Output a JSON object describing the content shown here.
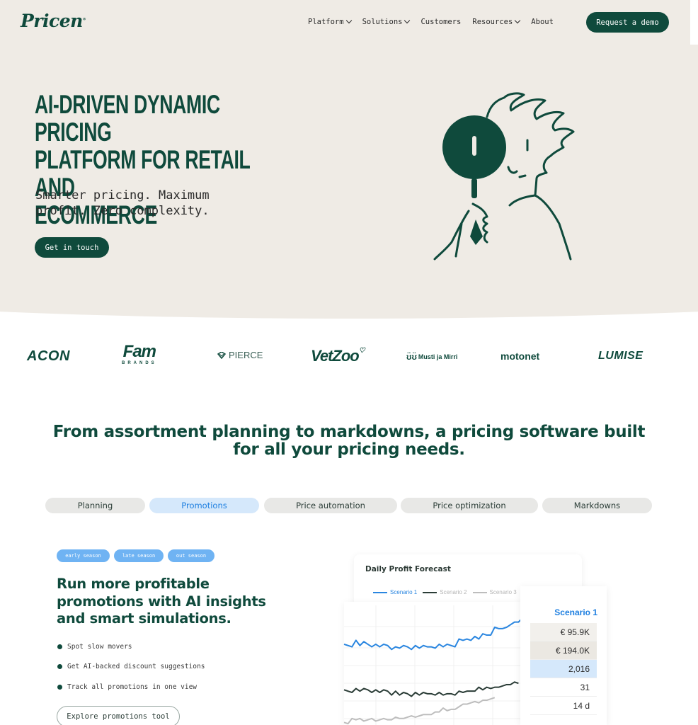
{
  "brand": {
    "name": "Pricen",
    "trademark": "®",
    "primary_color": "#0f4a3c",
    "accent_color": "#1e7fe0"
  },
  "nav": {
    "items": [
      {
        "label": "Platform",
        "has_dropdown": true
      },
      {
        "label": "Solutions",
        "has_dropdown": true
      },
      {
        "label": "Customers",
        "has_dropdown": false
      },
      {
        "label": "Resources",
        "has_dropdown": true
      },
      {
        "label": "About",
        "has_dropdown": false
      }
    ],
    "cta": "Request a demo"
  },
  "hero": {
    "title_lines": [
      "AI-DRIVEN DYNAMIC PRICING",
      "PLATFORM FOR RETAIL AND",
      "ECOMMERCE"
    ],
    "subtitle_lines": [
      "Smarter pricing. Maximum",
      "profit. Zero complexity."
    ],
    "cta": "Get in touch",
    "illustration": "person-with-magnifying-glass"
  },
  "customer_logos": [
    {
      "name": "ACON"
    },
    {
      "name": "Fam",
      "sub": "BRANDS"
    },
    {
      "name": "PIERCE"
    },
    {
      "name": "VetZoo"
    },
    {
      "name": "Musti ja Mirri"
    },
    {
      "name": "motonet"
    },
    {
      "name": "LUMISE"
    }
  ],
  "section": {
    "title_lines": [
      "From assortment planning to markdowns, a pricing software built",
      "for all your pricing needs."
    ],
    "tabs": [
      {
        "label": "Planning",
        "active": false
      },
      {
        "label": "Promotions",
        "active": true
      },
      {
        "label": "Price automation",
        "active": false
      },
      {
        "label": "Price optimization",
        "active": false
      },
      {
        "label": "Markdowns",
        "active": false
      }
    ]
  },
  "feature": {
    "chips": [
      "early season",
      "late season",
      "out season"
    ],
    "title_lines": [
      "Run more profitable",
      "promotions with AI insights",
      "and smart simulations."
    ],
    "bullets": [
      "Spot slow movers",
      "Get AI-backed discount suggestions",
      "Track all promotions in one view"
    ],
    "cta": "Explore promotions tool"
  },
  "forecast_card": {
    "title": "Daily Profit Forecast",
    "legend": [
      {
        "name": "Scenario 1",
        "color": "#2a86e0",
        "text_color": "#2a86e0"
      },
      {
        "name": "Scenario 2",
        "color": "#2b3d37",
        "text_color": "#b5b5b5"
      },
      {
        "name": "Scenario 3",
        "color": "#bdbdbd",
        "text_color": "#b5b5b5"
      }
    ],
    "panel": {
      "heading": "Scenario 1",
      "rows": [
        "€ 95.9K",
        "€ 194.0K",
        "2,016",
        "31",
        "14 d"
      ]
    }
  },
  "chart_data": {
    "type": "line",
    "title": "Daily Profit Forecast",
    "xlabel": "",
    "ylabel": "",
    "grid": true,
    "legend_position": "top",
    "x_count": 50,
    "ylim": [
      0,
      100
    ],
    "series": [
      {
        "name": "Scenario 1",
        "color": "#2a86e0",
        "values": [
          62,
          61,
          60,
          65,
          61,
          64,
          62,
          60,
          62,
          60,
          62,
          61,
          58,
          60,
          59,
          61,
          60,
          58,
          61,
          59,
          61,
          60,
          60,
          59,
          62,
          60,
          62,
          61,
          60,
          66,
          65,
          66,
          65,
          68,
          66,
          70,
          69,
          69,
          75,
          74,
          74,
          75,
          77,
          79,
          79,
          82,
          82,
          84,
          84,
          88,
          87,
          87,
          86,
          90,
          89,
          90,
          88,
          91,
          90,
          89,
          92,
          91
        ]
      },
      {
        "name": "Scenario 2",
        "color": "#2b3d37",
        "values": [
          27,
          26,
          25,
          28,
          26,
          28,
          27,
          25,
          27,
          25,
          27,
          26,
          23,
          26,
          23,
          25,
          24,
          22,
          25,
          23,
          25,
          24,
          24,
          23,
          25,
          23,
          24,
          24,
          23,
          26,
          25,
          26,
          26,
          26,
          29,
          27,
          29,
          28,
          29,
          29,
          30,
          31,
          31,
          33,
          32
        ]
      },
      {
        "name": "Scenario 3",
        "color": "#bdbdbd",
        "values": [
          2,
          1,
          5,
          4,
          5,
          3,
          4,
          5,
          3,
          4,
          5,
          4,
          4,
          6,
          5,
          5,
          6,
          7,
          6,
          7,
          8,
          8,
          8,
          10,
          10,
          13,
          11,
          12,
          12,
          14,
          16,
          16,
          17,
          18,
          17,
          19,
          19,
          20,
          21
        ]
      }
    ]
  }
}
